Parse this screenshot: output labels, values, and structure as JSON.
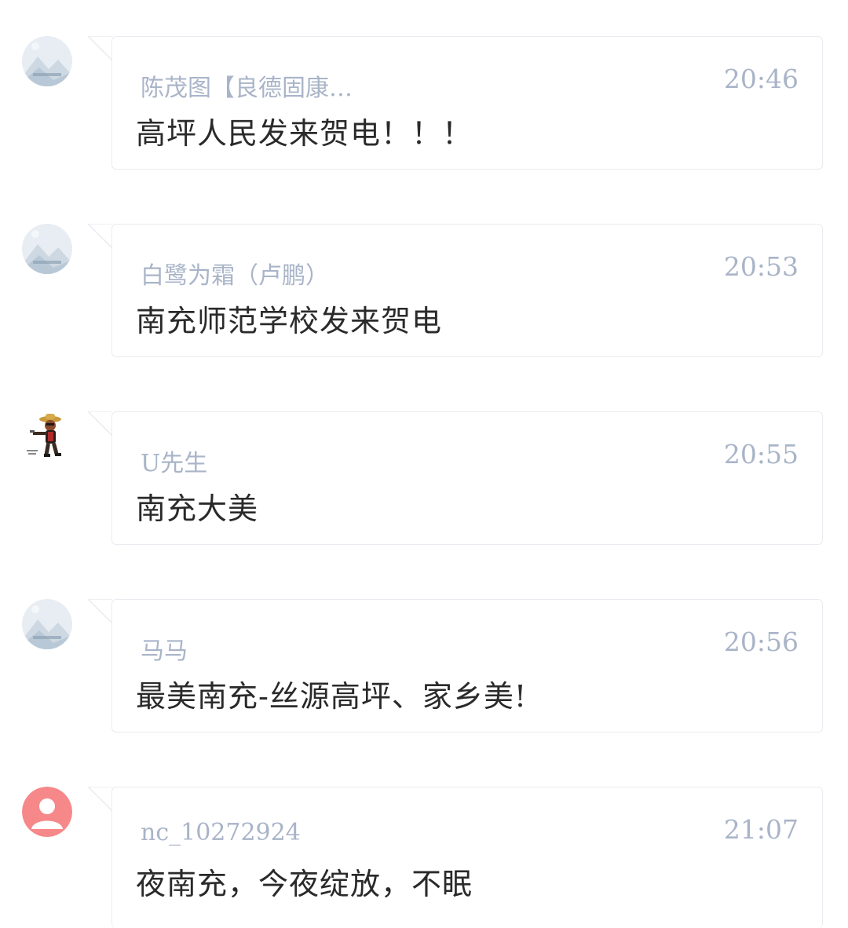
{
  "comments": [
    {
      "avatar": "landscape-placeholder-icon",
      "author": "陈茂图【良德固康…",
      "time": "20:46",
      "content": "高坪人民发来贺电！！！"
    },
    {
      "avatar": "landscape-placeholder-icon",
      "author": "白鹭为霜（卢鹏）",
      "time": "20:53",
      "content": "南充师范学校发来贺电"
    },
    {
      "avatar": "cartoon-character-avatar",
      "author": "U先生",
      "time": "20:55",
      "content": "南充大美"
    },
    {
      "avatar": "landscape-placeholder-icon",
      "author": "马马",
      "time": "20:56",
      "content": "最美南充-丝源高坪、家乡美!"
    },
    {
      "avatar": "default-user-icon",
      "author": "nc_10272924",
      "time": "21:07",
      "content": "夜南充，今夜绽放，不眠"
    }
  ],
  "colors": {
    "meta_text": "#a9b4c8",
    "body_text": "#2a2a2a",
    "bubble_border": "#e8ebf0",
    "default_avatar_bg": "#f6888a"
  }
}
